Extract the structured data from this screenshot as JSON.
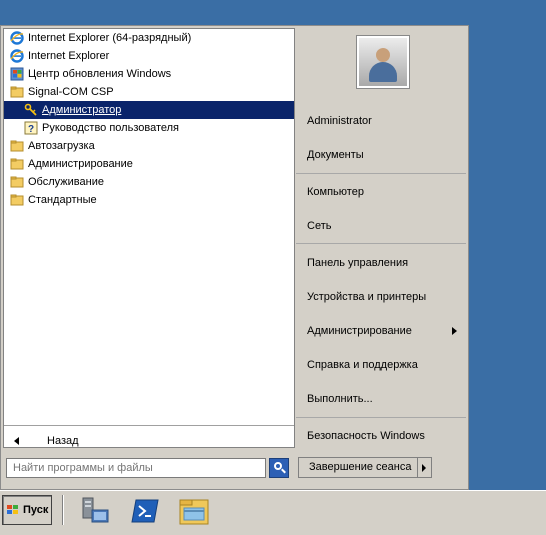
{
  "programs": [
    {
      "label": "Internet Explorer (64-разрядный)",
      "icon": "ie-icon",
      "indent": 0
    },
    {
      "label": "Internet Explorer",
      "icon": "ie-icon",
      "indent": 0
    },
    {
      "label": "Центр обновления Windows",
      "icon": "windows-update-icon",
      "indent": 0
    },
    {
      "label": "Signal-COM CSP",
      "icon": "folder-icon",
      "indent": 0
    },
    {
      "label": "Администратор",
      "icon": "key-tools-icon",
      "indent": 1,
      "selected": true
    },
    {
      "label": "Руководство пользователя",
      "icon": "help-icon",
      "indent": 1
    },
    {
      "label": "Автозагрузка",
      "icon": "folder-icon",
      "indent": 0
    },
    {
      "label": "Администрирование",
      "icon": "folder-icon",
      "indent": 0
    },
    {
      "label": "Обслуживание",
      "icon": "folder-icon",
      "indent": 0
    },
    {
      "label": "Стандартные",
      "icon": "folder-icon",
      "indent": 0
    }
  ],
  "back_label": "Назад",
  "search": {
    "placeholder": "Найти программы и файлы"
  },
  "right": {
    "user": "Administrator",
    "documents": "Документы",
    "computer": "Компьютер",
    "network": "Сеть",
    "control_panel": "Панель управления",
    "devices": "Устройства и принтеры",
    "admin_tools": "Администрирование",
    "help": "Справка и поддержка",
    "run": "Выполнить...",
    "security": "Безопасность Windows"
  },
  "shutdown_label": "Завершение сеанса",
  "taskbar": {
    "start_label": "Пуск",
    "icons": [
      "server-manager-icon",
      "powershell-icon",
      "explorer-icon"
    ]
  },
  "colors": {
    "selection": "#0a246a",
    "desktop": "#3a6ea5",
    "chrome": "#d4d0c8"
  }
}
